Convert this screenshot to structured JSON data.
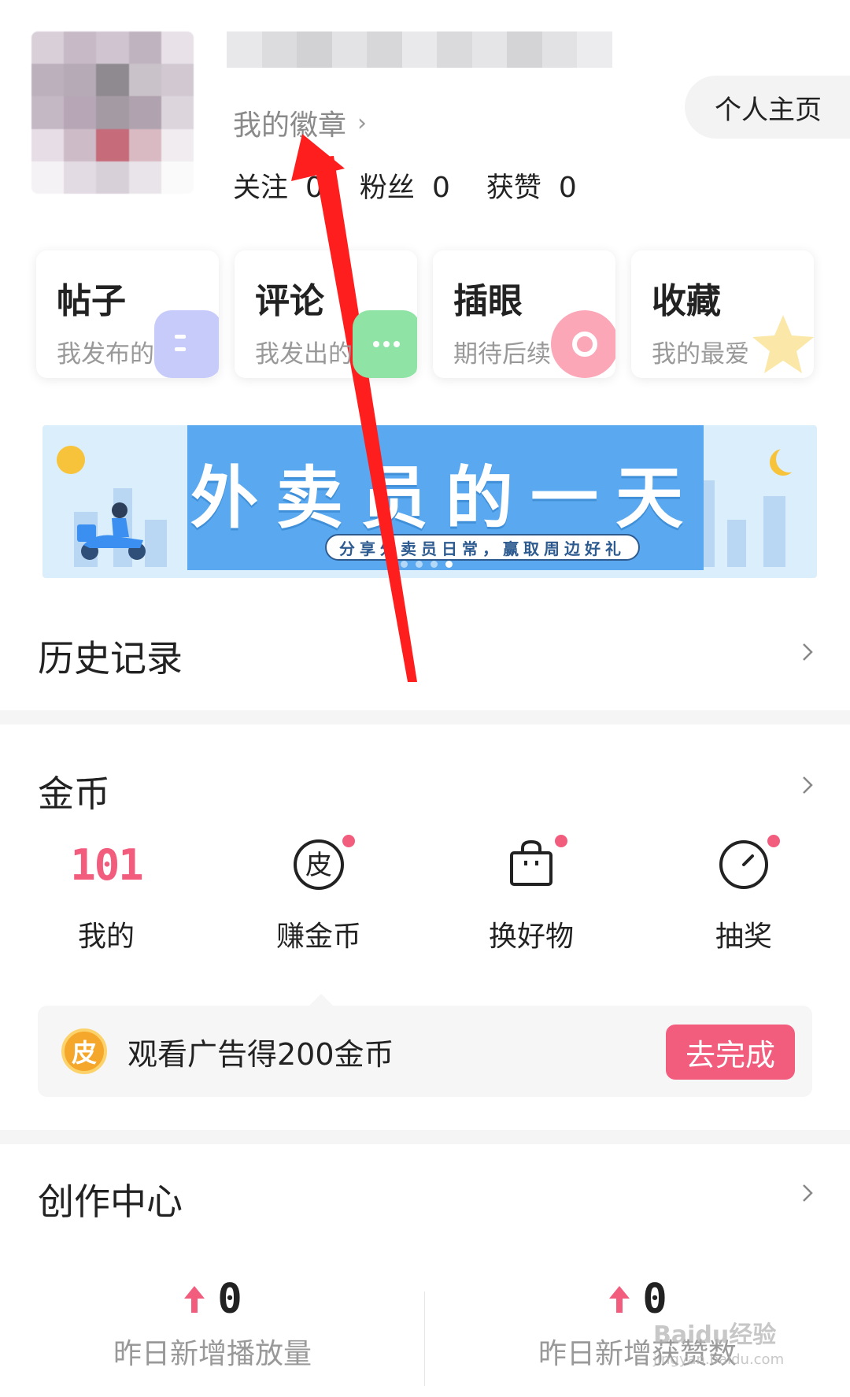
{
  "profile": {
    "badge_label": "我的徽章",
    "home_button": "个人主页",
    "stats": [
      {
        "label": "关注",
        "value": "0"
      },
      {
        "label": "粉丝",
        "value": "0"
      },
      {
        "label": "获赞",
        "value": "0"
      }
    ]
  },
  "cards": [
    {
      "title": "帖子",
      "sub": "我发布的",
      "color": "#7d86f0"
    },
    {
      "title": "评论",
      "sub": "我发出的",
      "color": "#46cf6a"
    },
    {
      "title": "插眼",
      "sub": "期待后续",
      "color": "#f25d7e"
    },
    {
      "title": "收藏",
      "sub": "我的最爱",
      "color": "#f8d36a"
    }
  ],
  "banner": {
    "title": "外卖员的一天",
    "subtitle": "分享外卖员日常，赢取周边好礼"
  },
  "history": {
    "title": "历史记录"
  },
  "coins": {
    "title": "金币",
    "my_count": "101",
    "items": [
      {
        "label": "我的"
      },
      {
        "label": "赚金币",
        "icon": "pi-coin-icon"
      },
      {
        "label": "换好物",
        "icon": "shopping-bag-icon"
      },
      {
        "label": "抽奖",
        "icon": "dial-icon"
      }
    ],
    "task": {
      "icon_char": "皮",
      "text": "观看广告得200金币",
      "button": "去完成"
    }
  },
  "creation": {
    "title": "创作中心",
    "stats": [
      {
        "value": "0",
        "label": "昨日新增播放量"
      },
      {
        "value": "0",
        "label": "昨日新增获赞数"
      }
    ]
  },
  "watermark": {
    "main": "Baidu经验",
    "url": "jingyan.baidu.com"
  },
  "colors": {
    "accent": "#f25d7e",
    "annotation": "#ff1e1e"
  }
}
